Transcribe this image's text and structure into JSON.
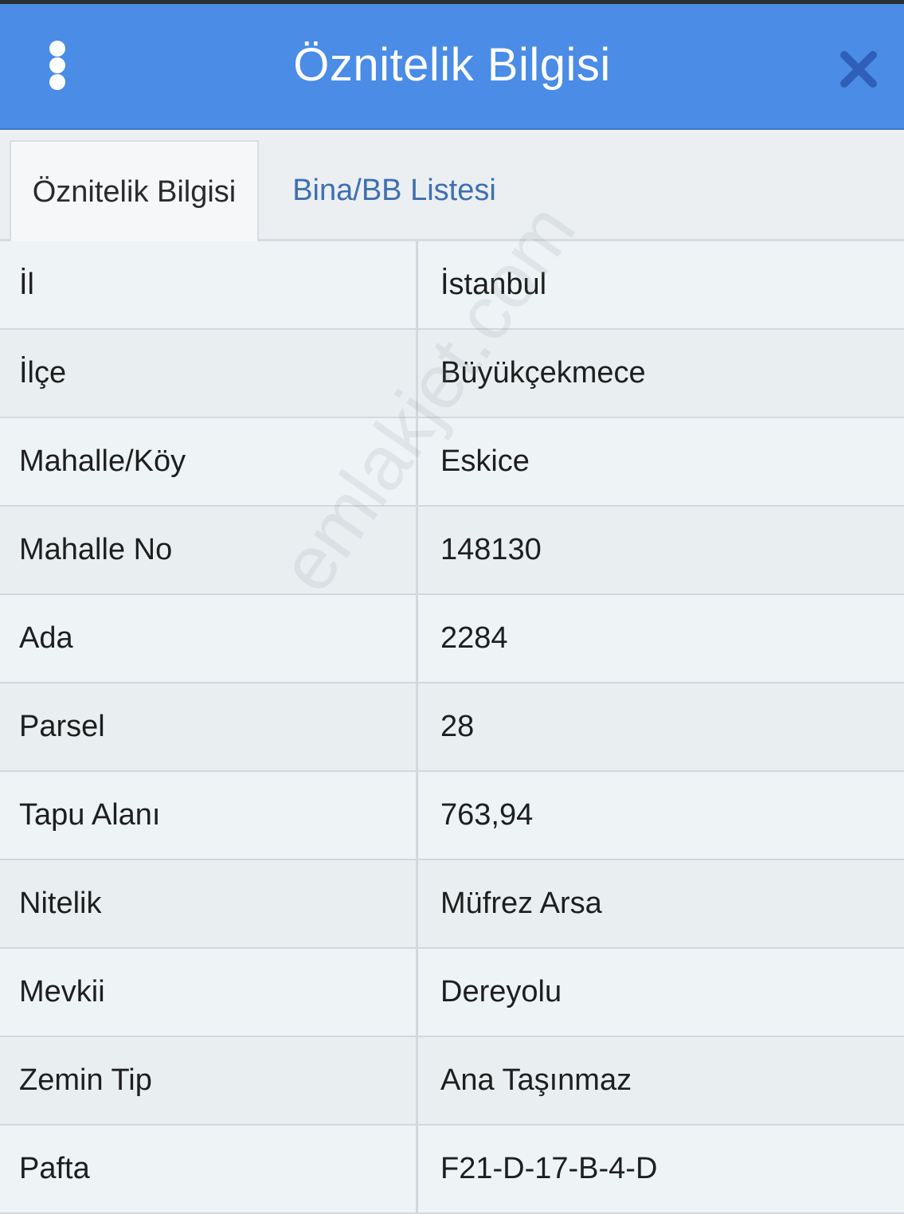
{
  "header": {
    "title": "Öznitelik Bilgisi",
    "menu_icon": "vertical-dots-icon",
    "close_icon": "close-icon",
    "bg_color": "#4a8ce6"
  },
  "tabs": [
    {
      "label": "Öznitelik Bilgisi",
      "active": true
    },
    {
      "label": "Bina/BB Listesi",
      "active": false
    }
  ],
  "table": {
    "rows": [
      {
        "label": "İl",
        "value": "İstanbul"
      },
      {
        "label": "İlçe",
        "value": "Büyükçekmece"
      },
      {
        "label": "Mahalle/Köy",
        "value": "Eskice"
      },
      {
        "label": "Mahalle No",
        "value": "148130"
      },
      {
        "label": "Ada",
        "value": "2284"
      },
      {
        "label": "Parsel",
        "value": "28"
      },
      {
        "label": "Tapu Alanı",
        "value": "763,94"
      },
      {
        "label": "Nitelik",
        "value": "Müfrez Arsa"
      },
      {
        "label": "Mevkii",
        "value": "Dereyolu"
      },
      {
        "label": "Zemin Tip",
        "value": "Ana Taşınmaz"
      },
      {
        "label": "Pafta",
        "value": "F21-D-17-B-4-D"
      }
    ]
  },
  "watermark": "emlakjet.com"
}
